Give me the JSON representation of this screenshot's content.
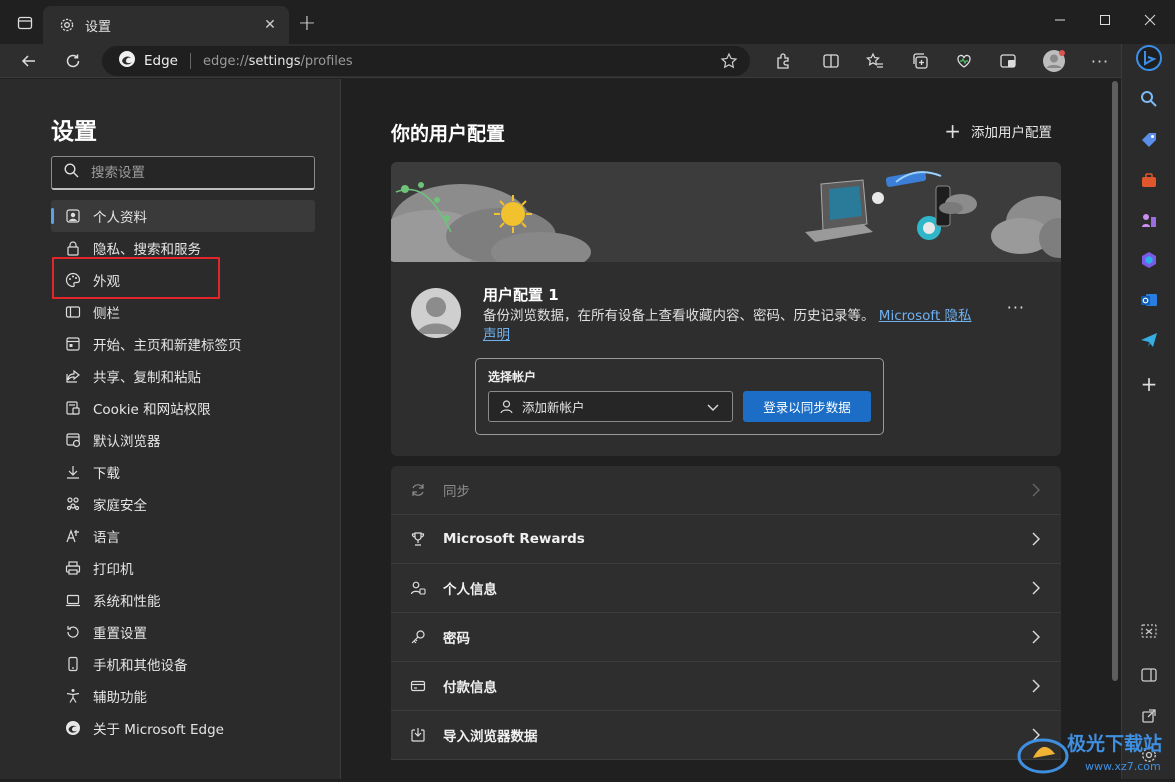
{
  "window": {
    "tab_title": "设置",
    "tab_close": "✕",
    "new_tab": "+"
  },
  "toolbar": {
    "brand": "Edge",
    "url_prefix": "edge://",
    "url_host": "settings",
    "url_path": "/profiles"
  },
  "sidebar": {
    "title": "设置",
    "search_placeholder": "搜索设置",
    "items": [
      {
        "label": "个人资料",
        "icon": "profile-icon"
      },
      {
        "label": "隐私、搜索和服务",
        "icon": "lock-icon"
      },
      {
        "label": "外观",
        "icon": "palette-icon"
      },
      {
        "label": "侧栏",
        "icon": "sidebar-icon"
      },
      {
        "label": "开始、主页和新建标签页",
        "icon": "home-icon"
      },
      {
        "label": "共享、复制和粘贴",
        "icon": "share-icon"
      },
      {
        "label": "Cookie 和网站权限",
        "icon": "cookie-icon"
      },
      {
        "label": "默认浏览器",
        "icon": "browser-icon"
      },
      {
        "label": "下载",
        "icon": "download-icon"
      },
      {
        "label": "家庭安全",
        "icon": "family-icon"
      },
      {
        "label": "语言",
        "icon": "language-icon"
      },
      {
        "label": "打印机",
        "icon": "printer-icon"
      },
      {
        "label": "系统和性能",
        "icon": "laptop-icon"
      },
      {
        "label": "重置设置",
        "icon": "reset-icon"
      },
      {
        "label": "手机和其他设备",
        "icon": "phone-icon"
      },
      {
        "label": "辅助功能",
        "icon": "accessibility-icon"
      },
      {
        "label": "关于 Microsoft Edge",
        "icon": "edge-icon"
      }
    ]
  },
  "main": {
    "title": "你的用户配置",
    "add_profile": "添加用户配置",
    "profile": {
      "name": "用户配置 1",
      "desc": "备份浏览数据，在所有设备上查看收藏内容、密码、历史记录等。",
      "link": "Microsoft 隐私声明",
      "more": "···"
    },
    "account": {
      "label": "选择帐户",
      "select_value": "添加新帐户",
      "sync_button": "登录以同步数据"
    },
    "list": [
      {
        "label": "同步",
        "icon": "sync-icon",
        "disabled": true
      },
      {
        "label": "Microsoft Rewards",
        "icon": "trophy-icon",
        "disabled": false
      },
      {
        "label": "个人信息",
        "icon": "person-info-icon",
        "disabled": false
      },
      {
        "label": "密码",
        "icon": "key-icon",
        "disabled": false
      },
      {
        "label": "付款信息",
        "icon": "card-icon",
        "disabled": false
      },
      {
        "label": "导入浏览器数据",
        "icon": "import-icon",
        "disabled": false
      }
    ]
  },
  "colors": {
    "accent": "#1b6dc6",
    "link": "#6fb1f0",
    "highlight": "#e0262a"
  }
}
